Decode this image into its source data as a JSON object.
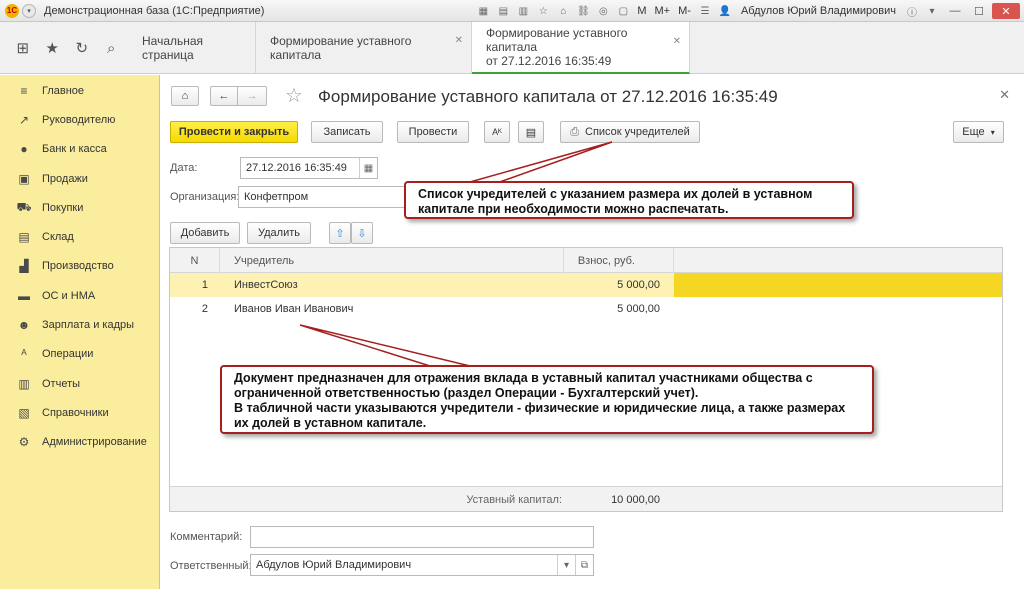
{
  "app": {
    "title": "Демонстрационная база  (1С:Предприятие)",
    "user": "Абдулов Юрий Владимирович",
    "m_buttons": [
      "M",
      "M+",
      "M-"
    ]
  },
  "tabs": {
    "home": "Начальная страница",
    "tab2": "Формирование уставного капитала",
    "tab3_line1": "Формирование уставного капитала",
    "tab3_line2": "от 27.12.2016 16:35:49"
  },
  "sidebar": {
    "items": [
      {
        "label": "Главное",
        "icon": "menu-icon"
      },
      {
        "label": "Руководителю",
        "icon": "chart-line-icon"
      },
      {
        "label": "Банк и касса",
        "icon": "ruble-icon"
      },
      {
        "label": "Продажи",
        "icon": "bag-icon"
      },
      {
        "label": "Покупки",
        "icon": "cart-icon"
      },
      {
        "label": "Склад",
        "icon": "warehouse-icon"
      },
      {
        "label": "Производство",
        "icon": "factory-icon"
      },
      {
        "label": "ОС и НМА",
        "icon": "truck-icon"
      },
      {
        "label": "Зарплата и кадры",
        "icon": "people-icon"
      },
      {
        "label": "Операции",
        "icon": "operations-icon"
      },
      {
        "label": "Отчеты",
        "icon": "bar-chart-icon"
      },
      {
        "label": "Справочники",
        "icon": "book-icon"
      },
      {
        "label": "Администрирование",
        "icon": "gear-icon"
      }
    ]
  },
  "document": {
    "title": "Формирование уставного капитала от 27.12.2016 16:35:49",
    "buttons": {
      "post_close": "Провести и закрыть",
      "save": "Записать",
      "post": "Провести",
      "founders_list": "Список учредителей",
      "more": "Еще"
    },
    "date_label": "Дата:",
    "date_value": "27.12.2016 16:35:49",
    "org_label": "Организация:",
    "org_value": "Конфетпром",
    "add": "Добавить",
    "delete": "Удалить",
    "comment_label": "Комментарий:",
    "comment_value": "",
    "responsible_label": "Ответственный:",
    "responsible_value": "Абдулов Юрий Владимирович"
  },
  "table": {
    "columns": [
      "N",
      "Учредитель",
      "Взнос, руб."
    ],
    "rows": [
      {
        "n": "1",
        "founder": "ИнвестСоюз",
        "amount": "5 000,00"
      },
      {
        "n": "2",
        "founder": "Иванов Иван Иванович",
        "amount": "5 000,00"
      }
    ],
    "footer_label": "Уставный капитал:",
    "footer_value": "10 000,00"
  },
  "callouts": {
    "founders_note": "Список учредителей с указанием размера их долей в уставном капитале при необходимости можно распечатать.",
    "doc_note_line1": "Документ предназначен для отражения вклада в уставный капитал участниками общества с ограниченной ответственностью (раздел Операции - Бухгалтерский учет).",
    "doc_note_line2": "В табличной части указываются учредители - физические и юридические лица, а также размерах их долей в уставном капитале."
  },
  "colors": {
    "sidebar_bg": "#fbed9e",
    "primary_button": "#f5d900",
    "selected_row": "#fdf2b3",
    "callout_border": "#a61f1f",
    "active_tab_underline": "#3da23a"
  }
}
